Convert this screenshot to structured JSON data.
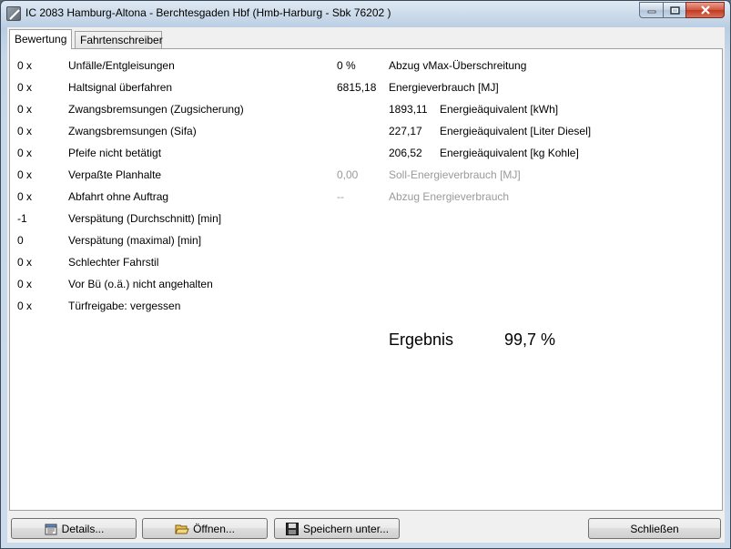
{
  "window": {
    "title": "IC 2083 Hamburg-Altona - Berchtesgaden Hbf (Hmb-Harburg - Sbk 76202 )"
  },
  "tabs": [
    {
      "label": "Bewertung",
      "active": true
    },
    {
      "label": "Fahrtenschreiber",
      "active": false
    }
  ],
  "penalties": [
    {
      "count": "0 x",
      "label": "Unfälle/Entgleisungen"
    },
    {
      "count": "0 x",
      "label": "Haltsignal überfahren"
    },
    {
      "count": "0 x",
      "label": "Zwangsbremsungen (Zugsicherung)"
    },
    {
      "count": "0 x",
      "label": "Zwangsbremsungen (Sifa)"
    },
    {
      "count": "0 x",
      "label": "Pfeife nicht betätigt"
    },
    {
      "count": "0 x",
      "label": "Verpaßte Planhalte"
    },
    {
      "count": "0 x",
      "label": "Abfahrt ohne Auftrag"
    },
    {
      "count": "-1",
      "label": "Verspätung (Durchschnitt) [min]"
    },
    {
      "count": "0",
      "label": "Verspätung (maximal) [min]"
    },
    {
      "count": "0 x",
      "label": "Schlechter Fahrstil"
    },
    {
      "count": "0 x",
      "label": "Vor Bü (o.ä.) nicht angehalten"
    },
    {
      "count": "0 x",
      "label": "Türfreigabe: vergessen"
    }
  ],
  "energy": {
    "vmax": {
      "value": "0 %",
      "label": "Abzug vMax-Überschreitung"
    },
    "consumption": {
      "value": "6815,18",
      "label": "Energieverbrauch [MJ]"
    },
    "equivalents": [
      {
        "value": "1893,11",
        "label": "Energieäquivalent [kWh]"
      },
      {
        "value": "227,17",
        "label": "Energieäquivalent [Liter Diesel]"
      },
      {
        "value": "206,52",
        "label": "Energieäquivalent [kg Kohle]"
      }
    ],
    "target": {
      "value": "0,00",
      "label": "Soll-Energieverbrauch [MJ]"
    },
    "deduction": {
      "value": "--",
      "label": "Abzug Energieverbrauch"
    }
  },
  "result": {
    "label": "Ergebnis",
    "value": "99,7 %"
  },
  "buttons": {
    "details": "Details...",
    "open": "Öffnen...",
    "save": "Speichern unter...",
    "close": "Schließen"
  },
  "icons": {
    "app": "train-app-icon",
    "details": "details-icon",
    "open": "folder-open-icon",
    "save": "floppy-disk-icon"
  }
}
